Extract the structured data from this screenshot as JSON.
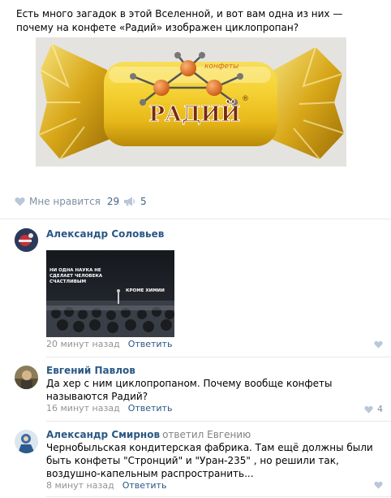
{
  "post": {
    "text": "Есть много загадок в этой Вселенной, и вот вам одна из них — почему на конфете «Радий» изображен циклопропан?",
    "photo": {
      "wrapper_text": "конфеты",
      "brand_text": "РАДИЙ",
      "registered_mark": "®"
    }
  },
  "actions": {
    "like_label": "Мне нравится",
    "like_count": "29",
    "share_count": "5"
  },
  "comments": [
    {
      "author": "Александр Соловьев",
      "meme_text_top": "НИ ОДНА НАУКА НЕ СДЕЛАЕТ ЧЕЛОВЕКА СЧАСТЛИВЫМ",
      "meme_text_side": "КРОМЕ ХИМИИ",
      "time": "20 минут назад",
      "reply_label": "Ответить"
    },
    {
      "author": "Евгений Павлов",
      "text": "Да хер с ним циклопропаном. Почему вообще конфеты называются Радий?",
      "time": "16 минут назад",
      "reply_label": "Ответить",
      "likes": "4"
    },
    {
      "author": "Александр Смирнов",
      "replied_to": "ответил Евгению",
      "text": "Чернобыльская кондитерская фабрика. Там ещё должны были быть конфеты \"Стронций\" и \"Уран-235\" , но решили так, воздушно-капельным распространить...",
      "time": "8 минут назад",
      "reply_label": "Ответить"
    }
  ],
  "colors": {
    "link": "#2a5885",
    "muted": "#939393",
    "icon": "#b8c7d9"
  }
}
